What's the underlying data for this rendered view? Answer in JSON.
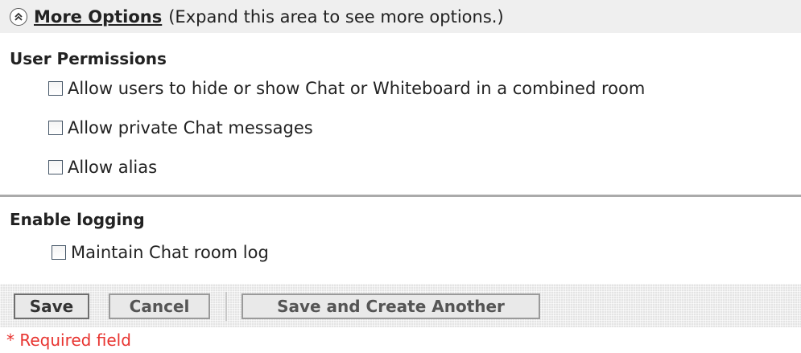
{
  "more_options": {
    "icon": "double-chevron-up-icon",
    "link_label": "More Options",
    "hint": "(Expand this area to see more options.)"
  },
  "user_permissions": {
    "title": "User Permissions",
    "options": [
      {
        "label": "Allow users to hide or show Chat or Whiteboard in a combined room",
        "checked": false
      },
      {
        "label": "Allow private Chat messages",
        "checked": false
      },
      {
        "label": "Allow alias",
        "checked": false
      }
    ]
  },
  "logging": {
    "title": "Enable logging",
    "options": [
      {
        "label": "Maintain Chat room log",
        "checked": false
      }
    ]
  },
  "buttons": {
    "save": "Save",
    "cancel": "Cancel",
    "save_and_create": "Save and Create Another"
  },
  "required_note": "* Required field",
  "colors": {
    "required_text": "#e8332f",
    "bar_background": "#efefef",
    "divider": "#aaaaaa"
  }
}
